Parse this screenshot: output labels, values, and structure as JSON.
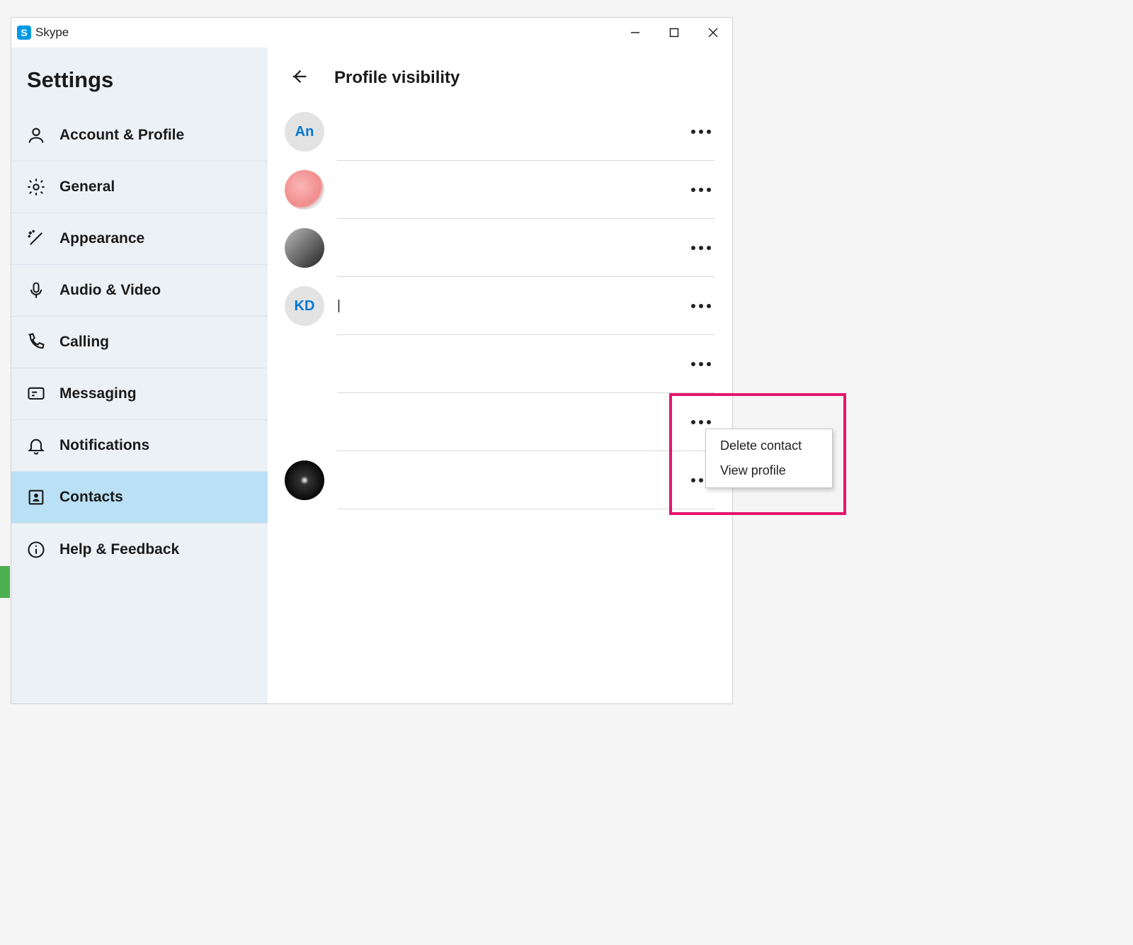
{
  "app": {
    "title": "Skype"
  },
  "sidebar": {
    "title": "Settings",
    "items": [
      {
        "label": "Account & Profile"
      },
      {
        "label": "General"
      },
      {
        "label": "Appearance"
      },
      {
        "label": "Audio & Video"
      },
      {
        "label": "Calling"
      },
      {
        "label": "Messaging"
      },
      {
        "label": "Notifications"
      },
      {
        "label": "Contacts"
      },
      {
        "label": "Help & Feedback"
      }
    ],
    "selected_index": 7
  },
  "main": {
    "title": "Profile visibility",
    "contacts": [
      {
        "initials": "An",
        "name": ""
      },
      {
        "initials": "",
        "name": ""
      },
      {
        "initials": "",
        "name": ""
      },
      {
        "initials": "KD",
        "name": "|"
      },
      {
        "initials": "",
        "name": ""
      },
      {
        "initials": "",
        "name": ""
      },
      {
        "initials": "",
        "name": ""
      }
    ]
  },
  "context_menu": {
    "items": [
      {
        "label": "Delete contact"
      },
      {
        "label": "View profile"
      }
    ]
  }
}
